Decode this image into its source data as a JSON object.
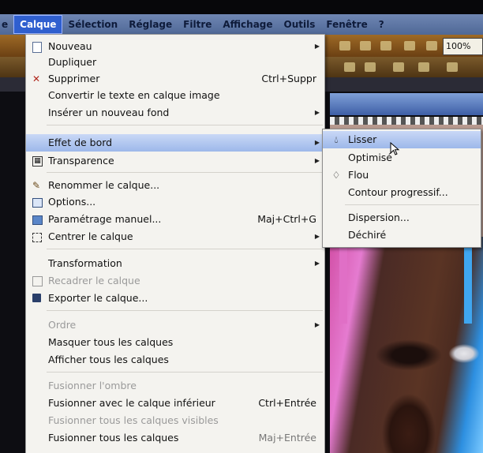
{
  "menubar": {
    "items": [
      "e",
      "Calque",
      "Sélection",
      "Réglage",
      "Filtre",
      "Affichage",
      "Outils",
      "Fenêtre",
      "?"
    ]
  },
  "toolbar": {
    "zoom": "100%"
  },
  "menu": {
    "items": {
      "nouveau": {
        "label": "Nouveau",
        "icon": "new-document-icon"
      },
      "dupliquer": {
        "label": "Dupliquer"
      },
      "supprimer": {
        "label": "Supprimer",
        "shortcut": "Ctrl+Suppr",
        "icon": "delete-x-icon"
      },
      "convertir": {
        "label": "Convertir le texte en calque image"
      },
      "inserer": {
        "label": "Insérer un nouveau fond"
      },
      "effet": {
        "label": "Effet de bord"
      },
      "transparence": {
        "label": "Transparence",
        "icon": "transparency-icon"
      },
      "renommer": {
        "label": "Renommer le calque..."
      },
      "options": {
        "label": "Options..."
      },
      "parametrage": {
        "label": "Paramétrage manuel...",
        "shortcut": "Maj+Ctrl+G"
      },
      "centrer": {
        "label": "Centrer le calque"
      },
      "transformation": {
        "label": "Transformation"
      },
      "recadrer": {
        "label": "Recadrer le calque"
      },
      "exporter": {
        "label": "Exporter le calque..."
      },
      "ordre": {
        "label": "Ordre"
      },
      "masquer": {
        "label": "Masquer tous les calques"
      },
      "afficher": {
        "label": "Afficher tous les calques"
      },
      "fusionner_ombre": {
        "label": "Fusionner l'ombre"
      },
      "fusionner_inferieur": {
        "label": "Fusionner avec le calque inférieur",
        "shortcut": "Ctrl+Entrée"
      },
      "fusionner_visibles": {
        "label": "Fusionner tous les calques visibles"
      },
      "fusionner_tous": {
        "label": "Fusionner tous les calques",
        "shortcut": "Maj+Entrée"
      }
    }
  },
  "submenu": {
    "items": {
      "lisser": {
        "label": "Lisser"
      },
      "optimise": {
        "label": "Optimisé"
      },
      "flou": {
        "label": "Flou"
      },
      "contour": {
        "label": "Contour progressif..."
      },
      "dispersion": {
        "label": "Dispersion..."
      },
      "dechire": {
        "label": "Déchiré"
      }
    }
  },
  "colors": {
    "highlight": "#9db8ea",
    "menubar": "#5a72a3",
    "toolbar": "#8a5a20"
  }
}
